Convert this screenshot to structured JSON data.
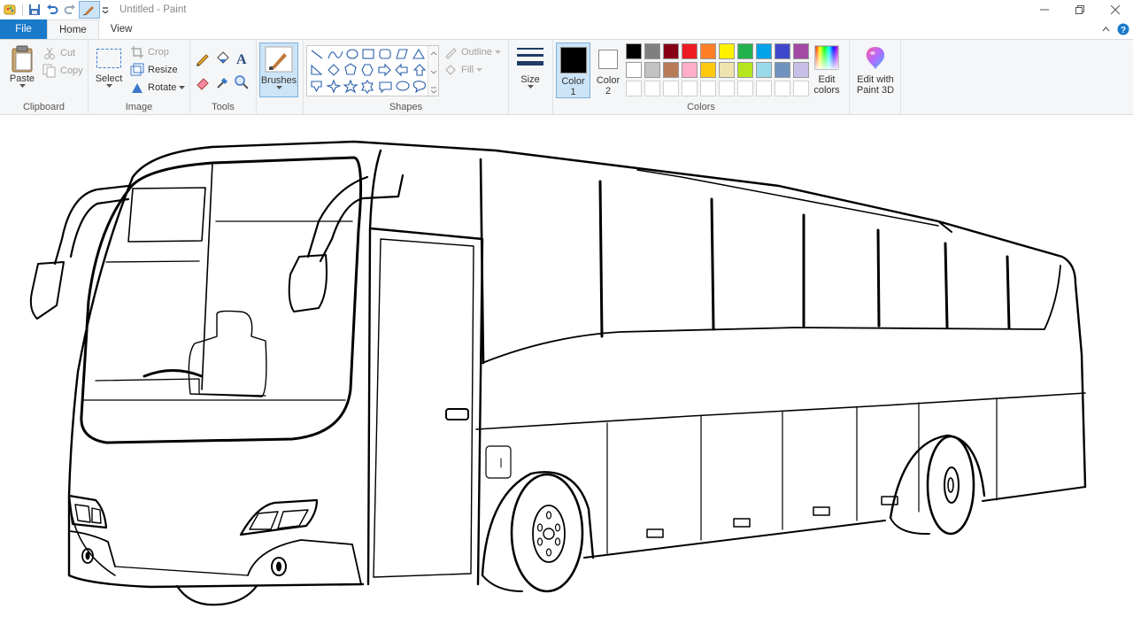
{
  "window": {
    "title": "Untitled - Paint"
  },
  "tabs": {
    "file": "File",
    "home": "Home",
    "view": "View"
  },
  "clipboard": {
    "paste": "Paste",
    "cut": "Cut",
    "copy": "Copy",
    "label": "Clipboard"
  },
  "image": {
    "select": "Select",
    "crop": "Crop",
    "resize": "Resize",
    "rotate": "Rotate",
    "label": "Image"
  },
  "tools": {
    "label": "Tools"
  },
  "brushes": {
    "label": "Brushes"
  },
  "shapes": {
    "outline": "Outline",
    "fill": "Fill",
    "label": "Shapes"
  },
  "size": {
    "label": "Size"
  },
  "colors": {
    "color1_label": "Color",
    "color1_num": "1",
    "color2_label": "Color",
    "color2_num": "2",
    "edit_colors_1": "Edit",
    "edit_colors_2": "colors",
    "paint3d_1": "Edit with",
    "paint3d_2": "Paint 3D",
    "label": "Colors",
    "color1_value": "#000000",
    "color2_value": "#ffffff",
    "palette_row1": [
      "#000000",
      "#7f7f7f",
      "#880015",
      "#ed1c24",
      "#ff7f27",
      "#fff200",
      "#22b14c",
      "#00a2e8",
      "#3f48cc",
      "#a349a4"
    ],
    "palette_row2": [
      "#ffffff",
      "#c3c3c3",
      "#b97a57",
      "#ffaec9",
      "#ffc90e",
      "#efe4b0",
      "#b5e61d",
      "#99d9ea",
      "#7092be",
      "#c8bfe7"
    ]
  },
  "icons": [
    "paint-app-icon",
    "save-icon",
    "undo-icon",
    "redo-icon",
    "brush-icon",
    "minimize-icon",
    "restore-icon",
    "close-icon",
    "help-icon",
    "collapse-ribbon-icon"
  ]
}
